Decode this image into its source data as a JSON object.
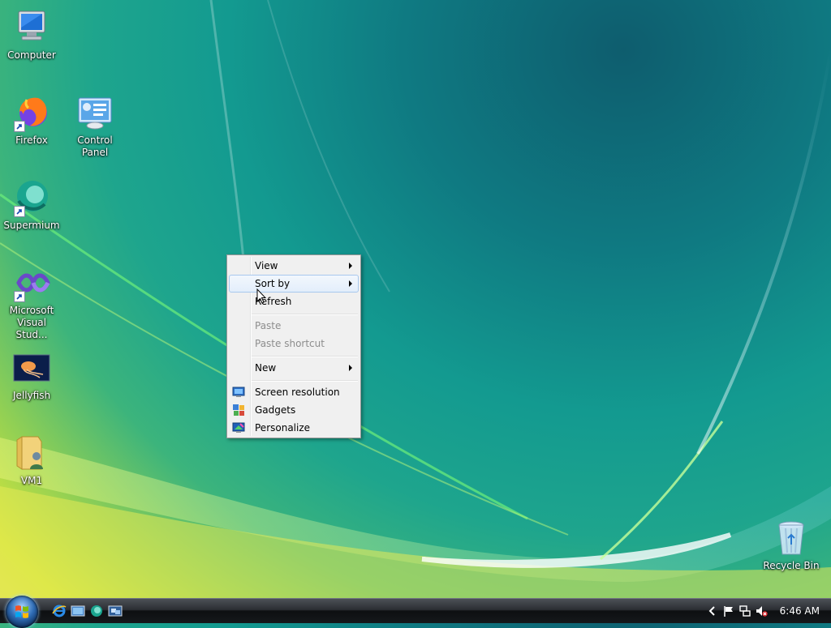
{
  "desktop": {
    "icons": [
      {
        "label": "Computer"
      },
      {
        "label": "Firefox"
      },
      {
        "label": "Control Panel"
      },
      {
        "label": "Supermium"
      },
      {
        "label": "Microsoft Visual Stud..."
      },
      {
        "label": "Jellyfish"
      },
      {
        "label": "VM1"
      },
      {
        "label": "Recycle Bin"
      }
    ]
  },
  "context_menu": {
    "items": [
      {
        "label": "View",
        "submenu": true,
        "enabled": true
      },
      {
        "label": "Sort by",
        "submenu": true,
        "enabled": true,
        "highlighted": true
      },
      {
        "label": "Refresh",
        "enabled": true
      },
      {
        "label": "Paste",
        "enabled": false
      },
      {
        "label": "Paste shortcut",
        "enabled": false
      },
      {
        "label": "New",
        "submenu": true,
        "enabled": true
      },
      {
        "label": "Screen resolution",
        "icon": "monitor-icon",
        "enabled": true
      },
      {
        "label": "Gadgets",
        "icon": "gadgets-icon",
        "enabled": true
      },
      {
        "label": "Personalize",
        "icon": "personalize-icon",
        "enabled": true
      }
    ]
  },
  "taskbar": {
    "quick_launch": [
      "internet-explorer-icon",
      "show-desktop-icon",
      "supermium-icon",
      "switch-windows-icon"
    ],
    "tray_icons": [
      "show-hidden-icons-chevron",
      "action-center-flag-icon",
      "network-icon",
      "volume-muted-icon"
    ],
    "clock": "6:46 AM"
  },
  "colors": {
    "menu_bg": "#f0f0f0",
    "menu_highlight": "#e3eefb",
    "disabled_text": "#8d8d8d",
    "taskbar": "#1b1e22"
  }
}
